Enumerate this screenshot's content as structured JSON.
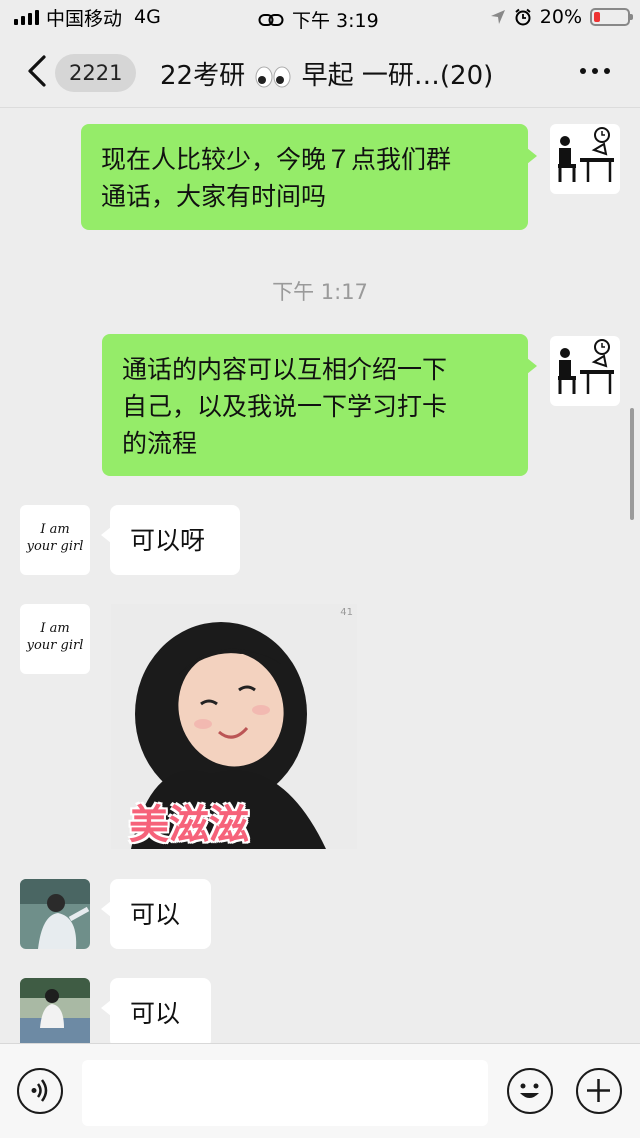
{
  "status_bar": {
    "carrier": "中国移动",
    "network": "4G",
    "time": "下午 3:19",
    "battery": "20%",
    "battery_level": 0.2
  },
  "nav": {
    "unread_count": "2221",
    "title_part1": "22考研",
    "title_part2": "早起  一研…(20)"
  },
  "messages": [
    {
      "side": "out",
      "type": "text",
      "line1": "现在人比较少，今晚７点我们群",
      "line2": "通话，大家有时间吗",
      "avatar": "desk-clock-avatar"
    },
    {
      "type": "time",
      "text": "下午 1:17"
    },
    {
      "side": "out",
      "type": "text",
      "line1": "通话的内容可以互相介绍一下",
      "line2": "自己，以及我说一下学习打卡",
      "line3": "的流程",
      "avatar": "desk-clock-avatar"
    },
    {
      "side": "in",
      "type": "text",
      "text": "可以呀",
      "avatar": "i-am-your-girl-avatar"
    },
    {
      "side": "in",
      "type": "sticker",
      "caption": "美滋滋",
      "number": "41",
      "avatar": "i-am-your-girl-avatar"
    },
    {
      "side": "in",
      "type": "text",
      "text": "可以",
      "avatar": "photo-avatar"
    },
    {
      "side": "in",
      "type": "text",
      "text": "可以",
      "avatar": "lakeside-photo-avatar"
    }
  ],
  "avatar_text": {
    "line1": "I am",
    "line2": "your girl"
  },
  "colors": {
    "outgoing_bubble": "#95ec69",
    "incoming_bubble": "#ffffff",
    "background": "#ededed"
  }
}
